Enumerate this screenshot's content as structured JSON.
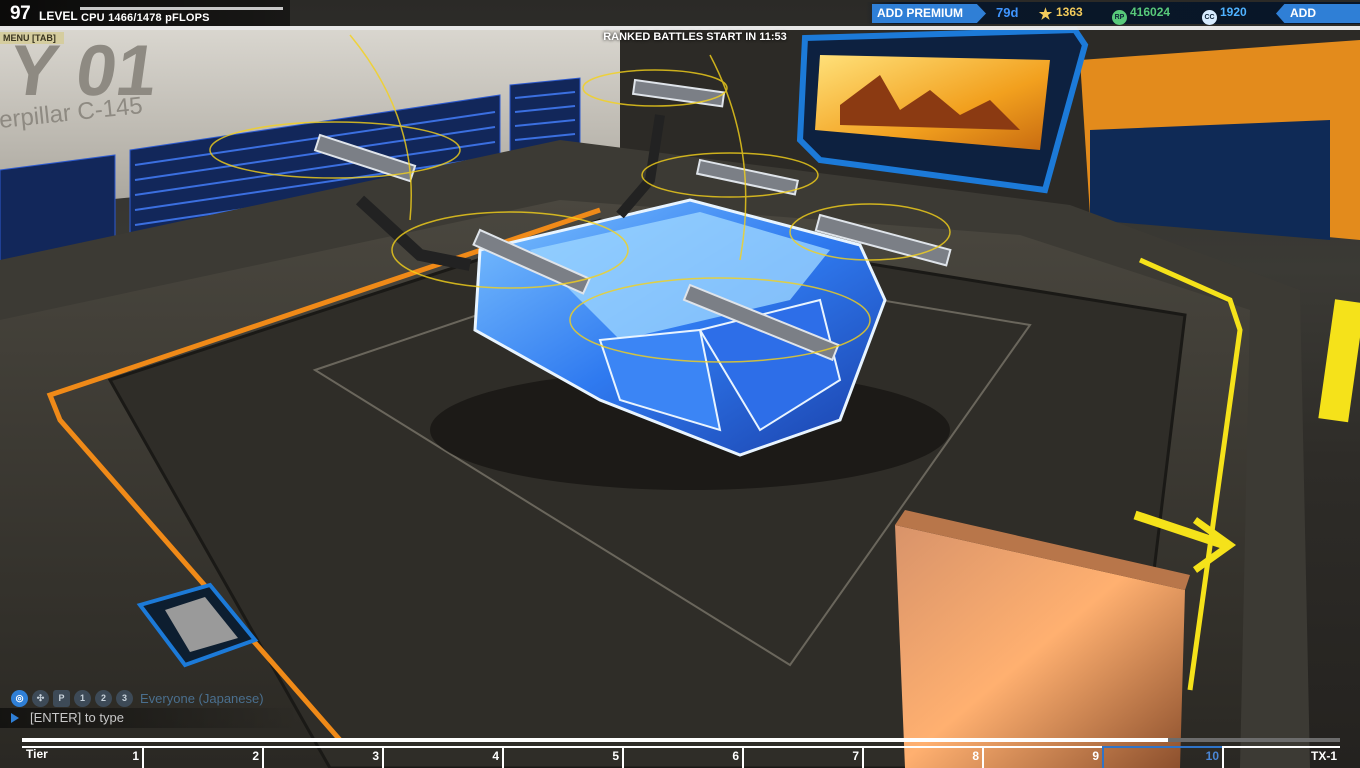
{
  "player": {
    "level_number": "97",
    "level_label": "LEVEL",
    "cpu_text": "CPU 1466/1478 pFLOPS",
    "cpu_fraction": 0.992
  },
  "menu": {
    "label": "MENU [TAB]"
  },
  "ranked": {
    "timer_text": "RANKED BATTLES START IN 11:53"
  },
  "garage": {
    "bay_title": "Y 01",
    "robot_name": "erpillar C-145"
  },
  "currency": {
    "add_premium_label": "ADD PREMIUM",
    "premium_days": "79d",
    "tech_points": "1363",
    "robits": "416024",
    "robits_icon_text": "RP",
    "cosmetic_credits": "1920",
    "cosmetic_credits_icon_text": "CC",
    "add_funds_label": "ADD FUNDS"
  },
  "chat": {
    "channel_name": "Everyone (Japanese)",
    "input_placeholder": "[ENTER] to type",
    "party_1": "1",
    "party_2": "2",
    "party_3": "3",
    "private_label": "P"
  },
  "tier_bar": {
    "label": "Tier",
    "tiers": [
      "1",
      "2",
      "3",
      "4",
      "5",
      "6",
      "7",
      "8",
      "9",
      "10",
      "TX-1"
    ],
    "current_tier": "10"
  },
  "colors": {
    "accent_blue": "#2f7fd6",
    "tech_points_gold": "#f3cb5b",
    "robits_green": "#58c97a",
    "cc_blue": "#4fb2ff",
    "floor_orange": "#f08a18",
    "floor_yellow": "#f5e21a"
  }
}
